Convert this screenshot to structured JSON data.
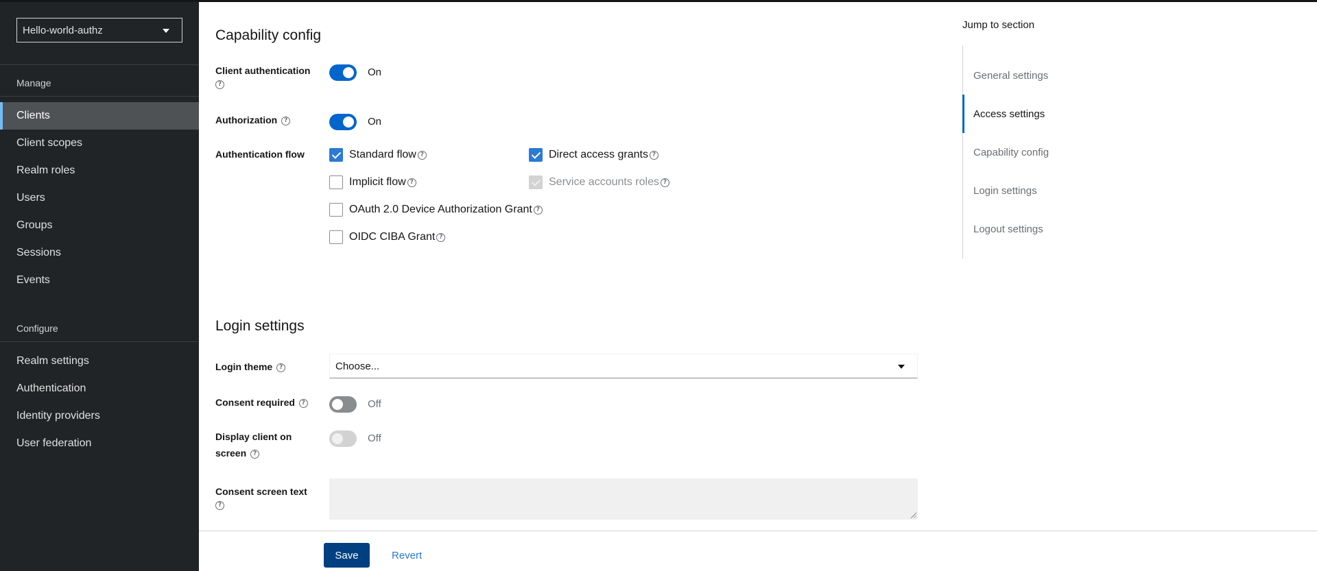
{
  "sidebar": {
    "realm": "Hello-world-authz",
    "sections": [
      {
        "title": "Manage",
        "items": [
          {
            "label": "Clients",
            "active": true
          },
          {
            "label": "Client scopes"
          },
          {
            "label": "Realm roles"
          },
          {
            "label": "Users"
          },
          {
            "label": "Groups"
          },
          {
            "label": "Sessions"
          },
          {
            "label": "Events"
          }
        ]
      },
      {
        "title": "Configure",
        "items": [
          {
            "label": "Realm settings"
          },
          {
            "label": "Authentication"
          },
          {
            "label": "Identity providers"
          },
          {
            "label": "User federation"
          }
        ]
      }
    ]
  },
  "capability": {
    "title": "Capability config",
    "client_auth": {
      "label": "Client authentication",
      "state": "On"
    },
    "authorization": {
      "label": "Authorization",
      "state": "On"
    },
    "auth_flow": {
      "label": "Authentication flow",
      "options": [
        {
          "label": "Standard flow",
          "checked": true
        },
        {
          "label": "Direct access grants",
          "checked": true
        },
        {
          "label": "Implicit flow",
          "checked": false
        },
        {
          "label": "Service accounts roles",
          "checked": true,
          "disabled": true
        },
        {
          "label": "OAuth 2.0 Device Authorization Grant",
          "checked": false
        },
        {
          "label": "OIDC CIBA Grant",
          "checked": false
        }
      ]
    }
  },
  "login": {
    "title": "Login settings",
    "login_theme": {
      "label": "Login theme",
      "placeholder": "Choose..."
    },
    "consent_required": {
      "label": "Consent required",
      "state": "Off"
    },
    "display_client": {
      "label_line1": "Display client on",
      "label_line2": "screen",
      "state": "Off"
    },
    "consent_text": {
      "label": "Consent screen text",
      "value": ""
    }
  },
  "footer": {
    "save": "Save",
    "revert": "Revert"
  },
  "jump": {
    "title": "Jump to section",
    "items": [
      {
        "label": "General settings"
      },
      {
        "label": "Access settings",
        "active": true
      },
      {
        "label": "Capability config"
      },
      {
        "label": "Login settings"
      },
      {
        "label": "Logout settings"
      }
    ]
  },
  "colors": {
    "accent": "#0066cc",
    "sidebar_bg": "#212427",
    "save_bg": "#004080"
  }
}
